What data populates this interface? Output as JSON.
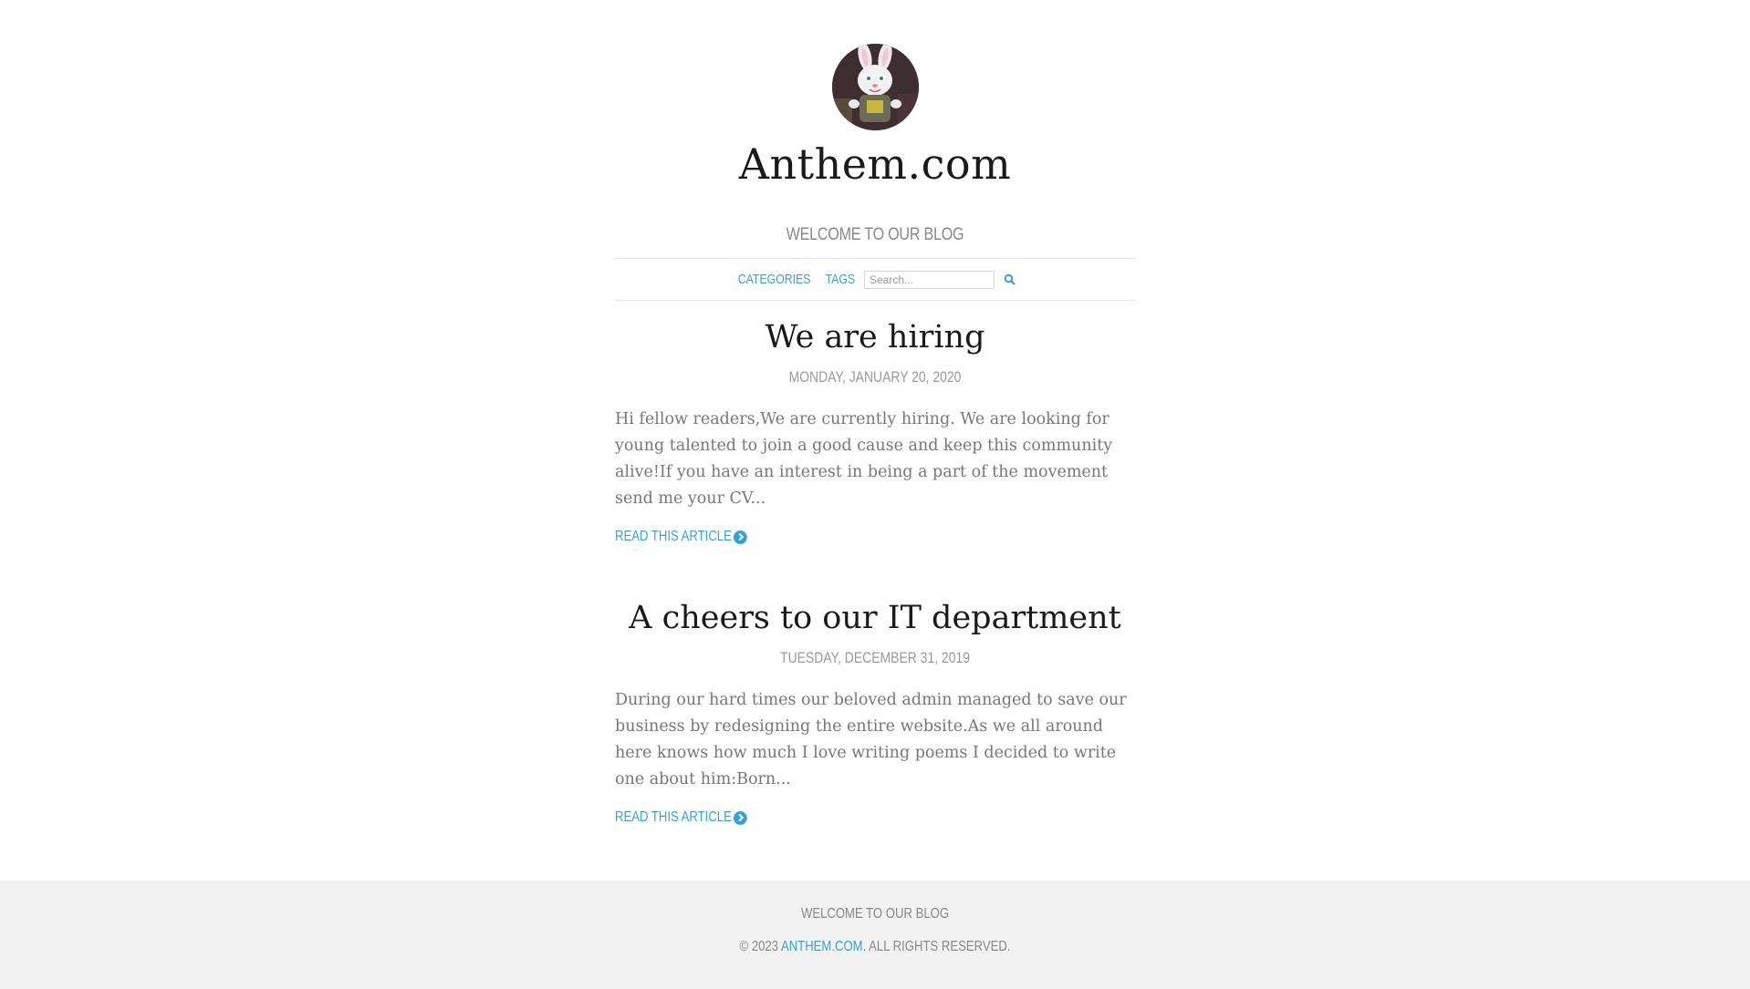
{
  "header": {
    "avatar_alt": "Easter bunny mascot avatar",
    "title": "Anthem.com",
    "tagline": "WELCOME TO OUR BLOG"
  },
  "nav": {
    "categories": "CATEGORIES",
    "tags": "TAGS",
    "search_placeholder": "Search...",
    "search_icon": "search-icon"
  },
  "posts": [
    {
      "title": "We are hiring",
      "date": "MONDAY, JANUARY 20, 2020",
      "excerpt": "Hi fellow readers,We are currently hiring. We are looking for young talented to join a good cause and keep this community alive!If you have an interest in being a part of the movement send me your CV...",
      "read_more": "READ THIS ARTICLE"
    },
    {
      "title": "A cheers to our IT department",
      "date": "TUESDAY, DECEMBER 31, 2019",
      "excerpt": "During our hard times our beloved admin managed to save our business by redesigning the entire website.As we all around here knows how much I love writing poems I decided to write one about him:Born...",
      "read_more": "READ THIS ARTICLE"
    }
  ],
  "footer": {
    "tagline": "WELCOME TO OUR BLOG",
    "copyright_prefix": "© 2023",
    "site_link": "ANTHEM.COM",
    "rights": ". ALL RIGHTS RESERVED."
  },
  "colors": {
    "accent": "#3a9fd6",
    "footer_bg": "#f2f2f2"
  }
}
